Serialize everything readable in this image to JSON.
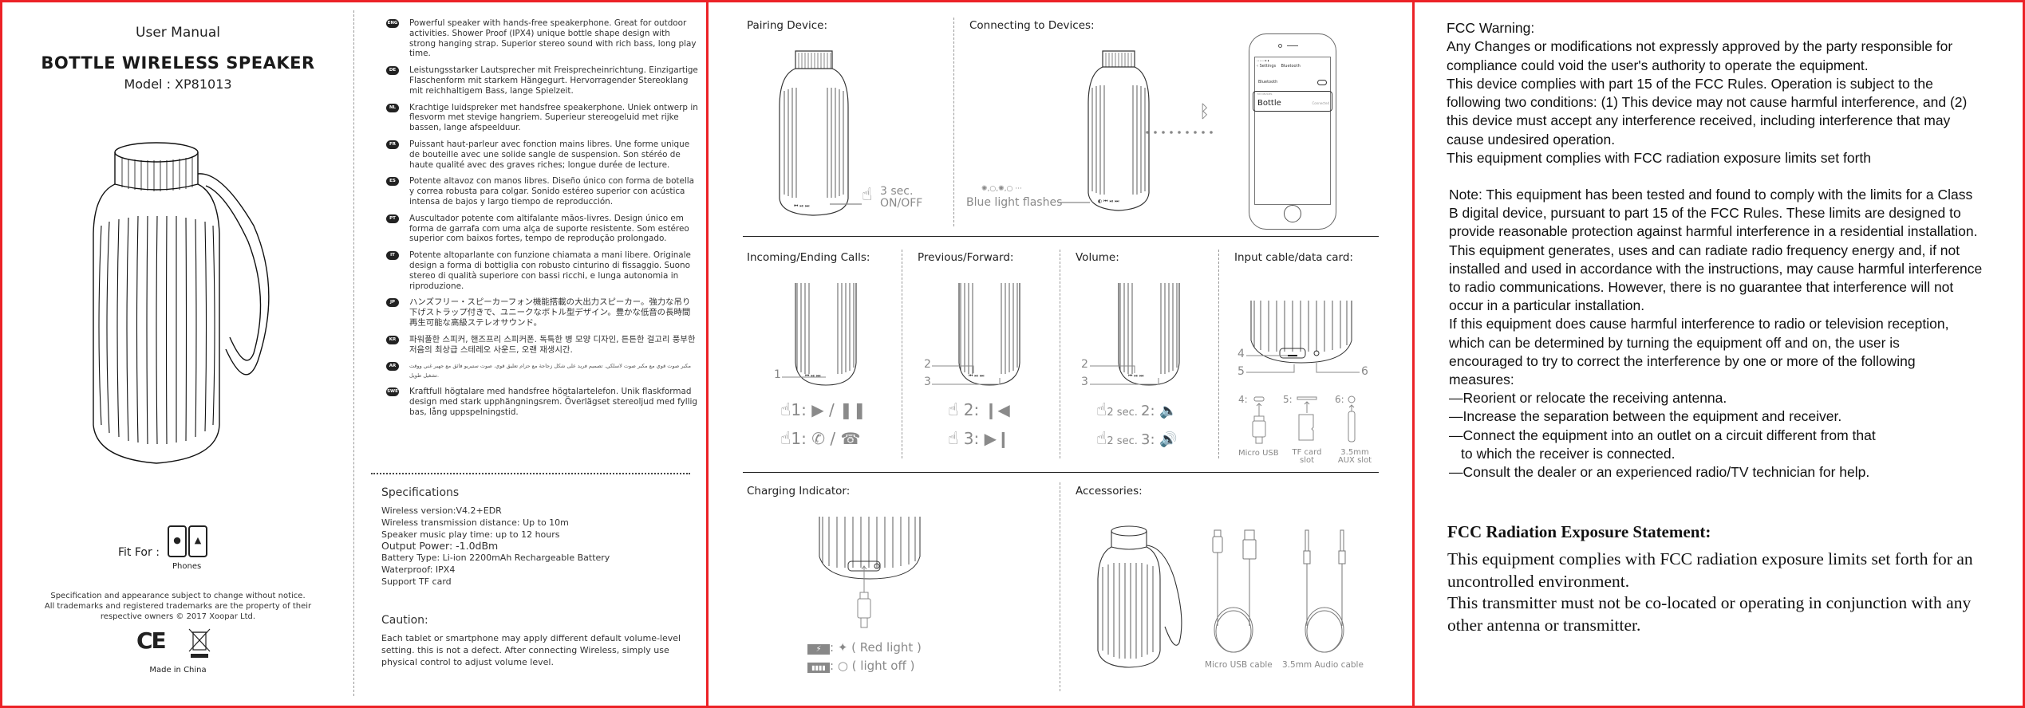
{
  "cover": {
    "subtitle": "User Manual",
    "title": "BOTTLE WIRELESS SPEAKER",
    "model": "Model : XP81013",
    "fit_for_label": "Fit For :",
    "phones_label": "Phones",
    "phone_icons": [
      "apple-icon",
      "android-icon"
    ],
    "legal_lines": [
      "Specification and appearance subject to change without notice.",
      "All trademarks and registered trademarks are the property of their",
      "respective owners © 2017 Xoopar Ltd."
    ],
    "ce_mark": "CE",
    "made_in": "Made in China"
  },
  "languages": [
    {
      "code": "ENG",
      "text": "Powerful speaker with hands-free speakerphone. Great for outdoor activities. Shower Proof (IPX4) unique bottle shape design with strong hanging strap. Superior stereo sound with rich bass, long play time."
    },
    {
      "code": "DE",
      "text": "Leistungsstarker Lautsprecher mit Freisprecheinrichtung. Einzigartige Flaschenform mit starkem Hängegurt. Hervorragender Stereoklang mit reichhaltigem Bass, lange Spielzeit."
    },
    {
      "code": "NL",
      "text": "Krachtige luidspreker met handsfree speakerphone. Uniek ontwerp in flesvorm met stevige hangriem. Superieur stereogeluid met rijke bassen, lange afspeelduur."
    },
    {
      "code": "FR",
      "text": "Puissant haut-parleur avec fonction mains libres. Une forme unique de bouteille avec une solide sangle de suspension. Son stéréo de haute qualité avec des graves riches; longue durée de lecture."
    },
    {
      "code": "ES",
      "text": "Potente altavoz con manos libres. Diseño único con forma de botella y correa robusta para colgar. Sonido estéreo superior con acústica intensa de bajos y largo tiempo de reproducción."
    },
    {
      "code": "PT",
      "text": "Auscultador potente com altifalante mãos-livres. Design único em forma de garrafa com uma alça de suporte resistente. Som estéreo superior com baixos fortes, tempo de reprodução prolongado."
    },
    {
      "code": "IT",
      "text": "Potente altoparlante con funzione chiamata a mani libere. Originale design a forma di bottiglia con robusto cinturino di fissaggio. Suono stereo di qualità superiore con bassi ricchi, e lunga autonomia in riproduzione."
    },
    {
      "code": "JP",
      "text": "ハンズフリー・スピーカーフォン機能搭載の大出力スピーカー。強力な吊り下げストラップ付きで、ユニークなボトル型デザイン。豊かな低音の長時間再生可能な高級ステレオサウンド。"
    },
    {
      "code": "KR",
      "text": "파워풀한 스피커, 핸즈프리 스피커폰. 독특한 병 모양 디자인, 튼튼한 걸고리 풍부한 저음의 최상급 스테레오 사운드, 오랜 재생시간."
    },
    {
      "code": "AR",
      "text": "مكبر صوت قوي مع مكبر صوت لاسلكي. تصميم فريد على شكل زجاجة مع حزام تعليق قوي. صوت ستيريو فائق مع جهير غني ووقت تشغيل طويل."
    },
    {
      "code": "SWE",
      "text": "Kraftfull högtalare med handsfree högtalartelefon. Unik flaskformad design med stark upphängningsrem. Överlägset stereoljud med fyllig bas, lång uppspelningstid."
    }
  ],
  "specifications": {
    "title": "Specifications",
    "rows": [
      "Wireless version:V4.2+EDR",
      "Wireless transmission distance: Up to 10m",
      "Speaker music play time: up to 12 hours",
      "Output Power: -1.0dBm",
      "Battery Type: Li-ion 2200mAh Rechargeable Battery",
      "Waterproof: IPX4",
      "Support TF card"
    ]
  },
  "caution": {
    "title": "Caution:",
    "text": "Each tablet or smartphone may apply different default volume-level setting. this is not a defect. After connecting Wireless, simply use physical control to adjust volume level."
  },
  "pairing": {
    "title": "Pairing Device:",
    "press_time": "3 sec.",
    "action": "ON/OFF"
  },
  "connecting": {
    "title": "Connecting to Devices:",
    "flash_pattern": "✺,○,✺,○ ···",
    "flash_label": "Blue light flashes",
    "phone": {
      "nav_back": "‹ Settings",
      "nav_title": "Bluetooth",
      "bluetooth_label": "Bluetooth",
      "devices_header": "MY DEVICES",
      "device_name": "Bottle",
      "device_status": "Connected"
    }
  },
  "calls": {
    "title": "Incoming/Ending Calls:",
    "callout": "1",
    "line1": "1: ▶ / ❚❚",
    "line2": "1: ✆ / ☎"
  },
  "prevnext": {
    "title": "Previous/Forward:",
    "callouts": [
      "2",
      "3"
    ],
    "line1": "2: ❙◀",
    "line2": "3: ▶❙"
  },
  "volume": {
    "title": "Volume:",
    "callouts": [
      "2",
      "3"
    ],
    "line1_time": "2 sec.",
    "line1": "2: 🔈",
    "line2_time": "2 sec.",
    "line2": "3: 🔊"
  },
  "input": {
    "title": "Input cable/data card:",
    "callouts": [
      "4",
      "5",
      "6"
    ],
    "ports": [
      {
        "num": "4:",
        "label": "Micro USB"
      },
      {
        "num": "5:",
        "label": "TF card slot"
      },
      {
        "num": "6:",
        "label": "3.5mm AUX slot"
      }
    ]
  },
  "charging": {
    "title": "Charging Indicator:",
    "state1": ": ✦ ( Red light )",
    "state2": ": ○ ( light off )"
  },
  "accessories": {
    "title": "Accessories:",
    "items": [
      "Micro USB cable",
      "3.5mm Audio cable"
    ]
  },
  "fcc": {
    "warning_title": "FCC Warning:",
    "paragraphs": [
      "Any Changes or modifications not expressly approved by the party responsible for compliance could void the user's authority to operate the equipment.",
      "This device complies with part 15 of the FCC Rules. Operation is subject to the following two conditions: (1) This device may not cause harmful interference, and (2) this device must accept any interference received, including interference that may cause undesired operation.",
      "This equipment complies with FCC radiation exposure limits set forth"
    ],
    "note": "Note: This equipment has been tested and found to comply with the limits for a Class B digital device, pursuant to part 15 of the FCC Rules. These limits are designed to provide reasonable protection against harmful interference in a residential installation. This equipment generates, uses and can radiate radio frequency energy and, if not installed and used in accordance with the instructions, may cause harmful interference to radio communications. However, there is no guarantee that interference will not occur in a particular installation.",
    "if_text": "If this equipment does cause harmful interference to radio or television reception, which can be determined by turning the equipment off and on, the user is encouraged to try to correct the interference by one or more of the following measures:",
    "measures": [
      "—Reorient or relocate the receiving antenna.",
      "—Increase the separation between the equipment and receiver.",
      "—Connect the equipment into an outlet on a circuit different from that",
      "to which the receiver is connected.",
      "—Consult the dealer or an experienced radio/TV technician for help."
    ],
    "radiation_title": "FCC Radiation Exposure Statement:",
    "radiation_paragraphs": [
      "This equipment complies with FCC radiation exposure limits set forth for an uncontrolled environment.",
      "This transmitter must not be co-located or operating in conjunction with any other antenna or transmitter."
    ]
  },
  "colors": {
    "border": "#ec2227",
    "text": "#222222",
    "muted": "#888888"
  }
}
